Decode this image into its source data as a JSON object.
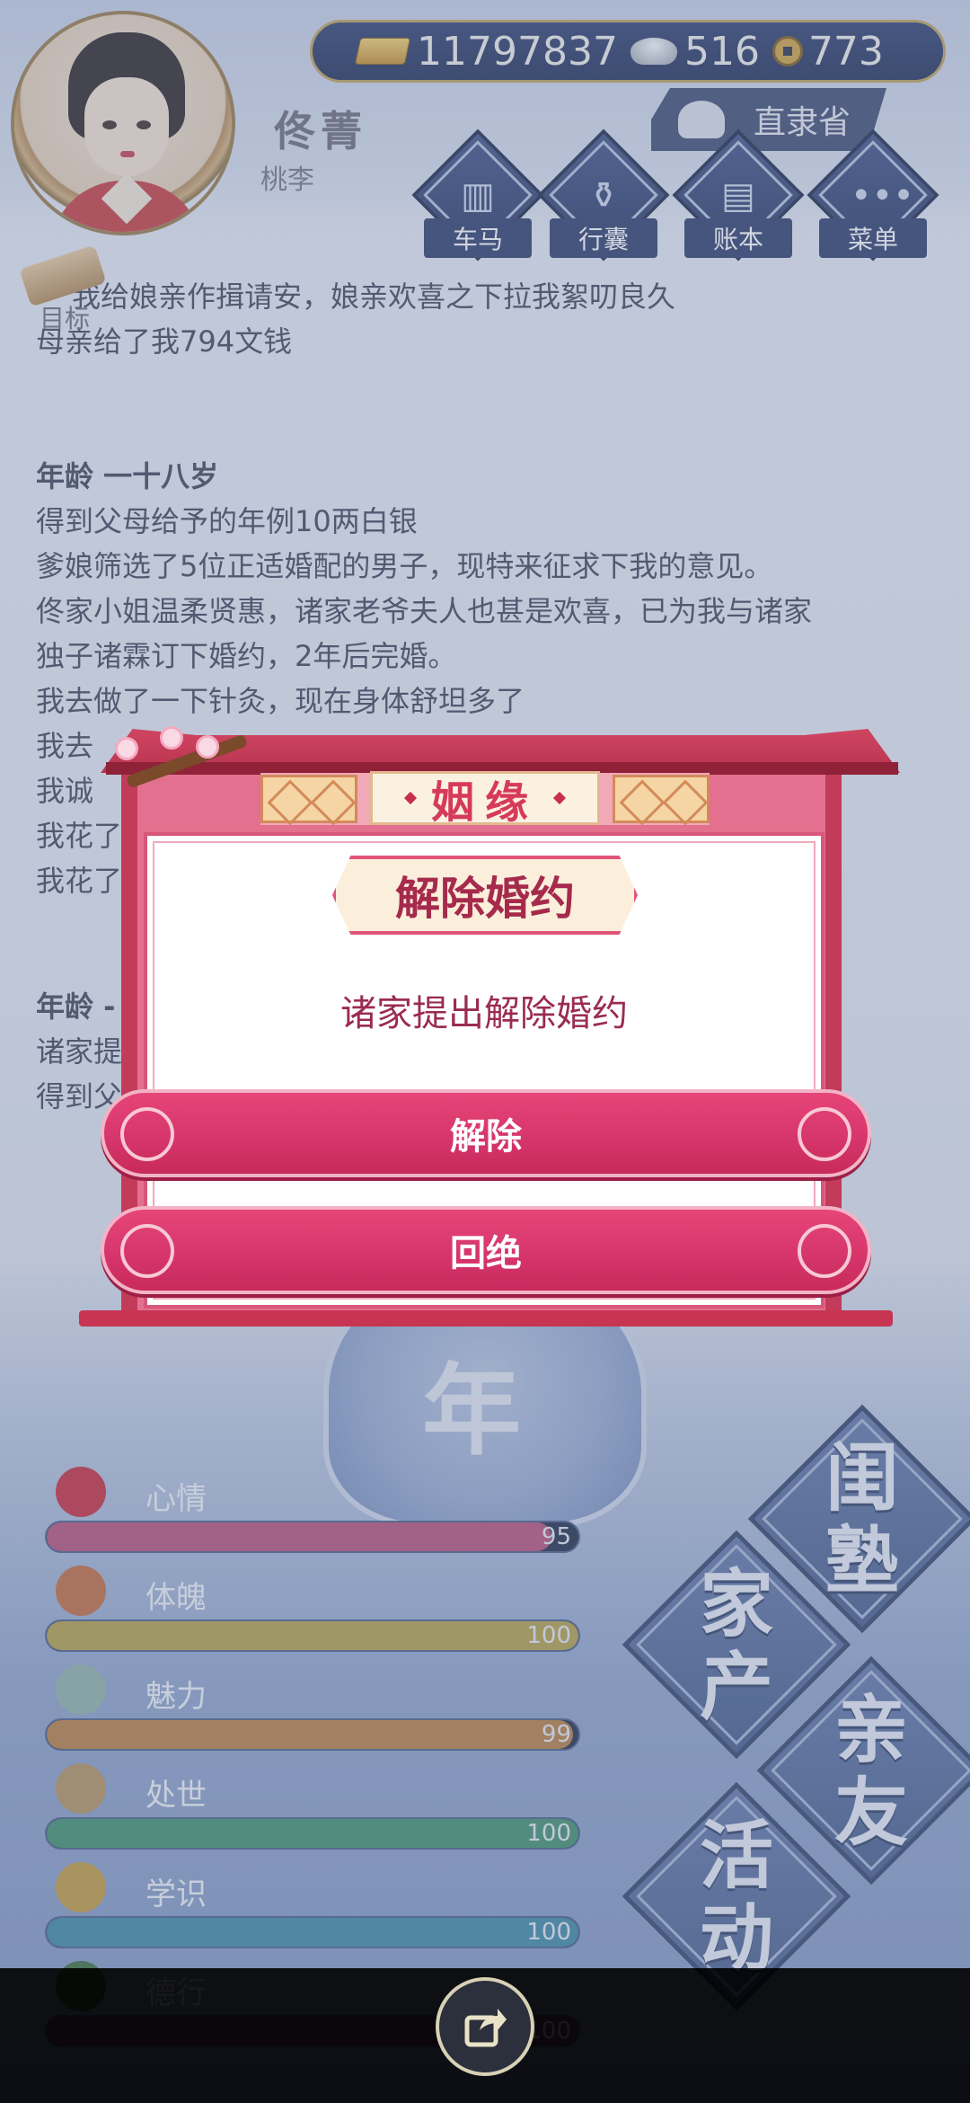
{
  "header": {
    "currency": {
      "gold": "11797837",
      "silver": "516",
      "coin": "773"
    },
    "player_name": "佟菁",
    "player_sub": "桃李",
    "location": "直隶省",
    "nav": [
      {
        "label": "车马",
        "icon": "carriage-icon"
      },
      {
        "label": "行囊",
        "icon": "bag-icon"
      },
      {
        "label": "账本",
        "icon": "ledger-icon"
      },
      {
        "label": "菜单",
        "icon": "menu-icon"
      }
    ],
    "goal_label": "目标"
  },
  "log": {
    "lines": [
      "我给娘亲作揖请安，娘亲欢喜之下拉我絮叨良久",
      "母亲给了我794文钱",
      "年龄 一十八岁",
      "得到父母给予的年例10两白银",
      "爹娘筛选了5位正适婚配的男子，现特来征求下我的意见。",
      "佟家小姐温柔贤惠，诸家老爷夫人也甚是欢喜，已为我与诸家",
      "独子诸霖订下婚约，2年后完婚。",
      "我去做了一下针灸，现在身体舒坦多了",
      "我去",
      "我诚",
      "我花了",
      "我花了",
      "年龄 -",
      "诸家提",
      "得到父"
    ]
  },
  "year_label": "年",
  "stats": [
    {
      "label": "心情",
      "value": "95",
      "fraction": 0.95,
      "color": "#b84e75",
      "icon": "flower-icon",
      "iconColor": "#c8283a"
    },
    {
      "label": "体魄",
      "value": "100",
      "fraction": 1.0,
      "color": "#b4a042",
      "icon": "body-icon",
      "iconColor": "#c46a3a"
    },
    {
      "label": "魅力",
      "value": "99",
      "fraction": 0.99,
      "color": "#b77f3d",
      "icon": "mirror-icon",
      "iconColor": "#8fb3a6"
    },
    {
      "label": "处世",
      "value": "100",
      "fraction": 1.0,
      "color": "#3e8f6a",
      "icon": "scroll-icon",
      "iconColor": "#b4915a"
    },
    {
      "label": "学识",
      "value": "100",
      "fraction": 1.0,
      "color": "#3b88a0",
      "icon": "books-icon",
      "iconColor": "#c49a3a"
    },
    {
      "label": "德行",
      "value": "100",
      "fraction": 1.0,
      "color": "#6a3f7a",
      "icon": "virtue-icon",
      "iconColor": "#3a6a3a"
    }
  ],
  "menu": [
    {
      "label": "闺塾",
      "chars": [
        "闺",
        "塾"
      ]
    },
    {
      "label": "家产",
      "chars": [
        "家",
        "产"
      ]
    },
    {
      "label": "亲友",
      "chars": [
        "亲",
        "友"
      ]
    },
    {
      "label": "活动",
      "chars": [
        "活",
        "动"
      ]
    }
  ],
  "modal": {
    "category": "姻缘",
    "title": "解除婚约",
    "message": "诸家提出解除婚约",
    "confirm_label": "解除",
    "reject_label": "回绝"
  },
  "share_icon": "share-icon"
}
